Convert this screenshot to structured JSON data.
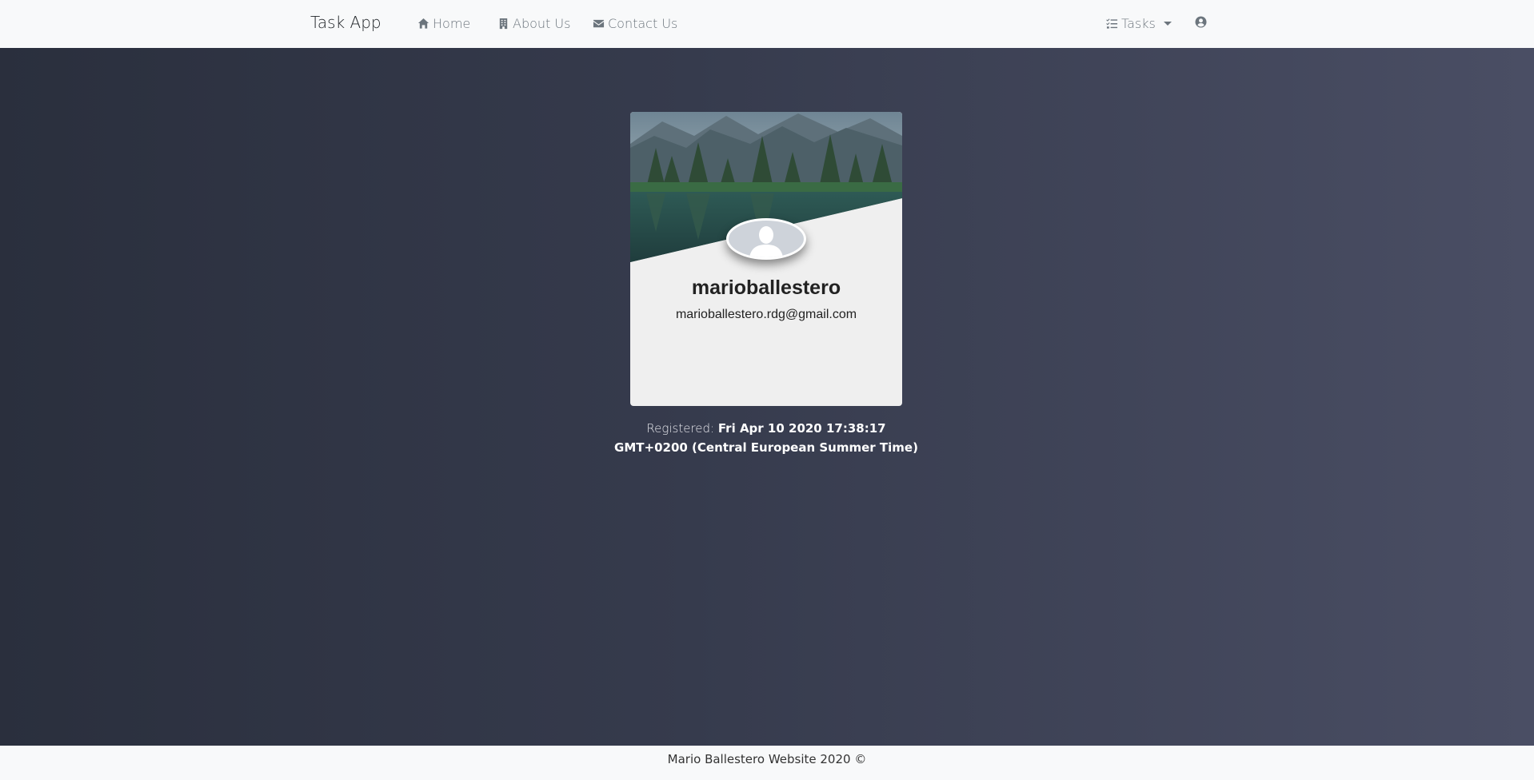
{
  "nav": {
    "brand": "Task App",
    "links": [
      {
        "label": "Home",
        "icon": "home-icon"
      },
      {
        "label": "About Us",
        "icon": "building-icon"
      },
      {
        "label": "Contact Us",
        "icon": "envelope-icon"
      }
    ],
    "tasks_label": "Tasks",
    "tasks_icon": "tasks-list-icon",
    "user_icon": "user-circle-icon"
  },
  "profile": {
    "username": "marioballestero",
    "email": "marioballestero.rdg@gmail.com",
    "registered_label": "Registered:",
    "registered_value": "Fri Apr 10 2020 17:38:17 GMT+0200 (Central European Summer Time)"
  },
  "footer": {
    "text": "Mario Ballestero Website 2020 ©"
  }
}
